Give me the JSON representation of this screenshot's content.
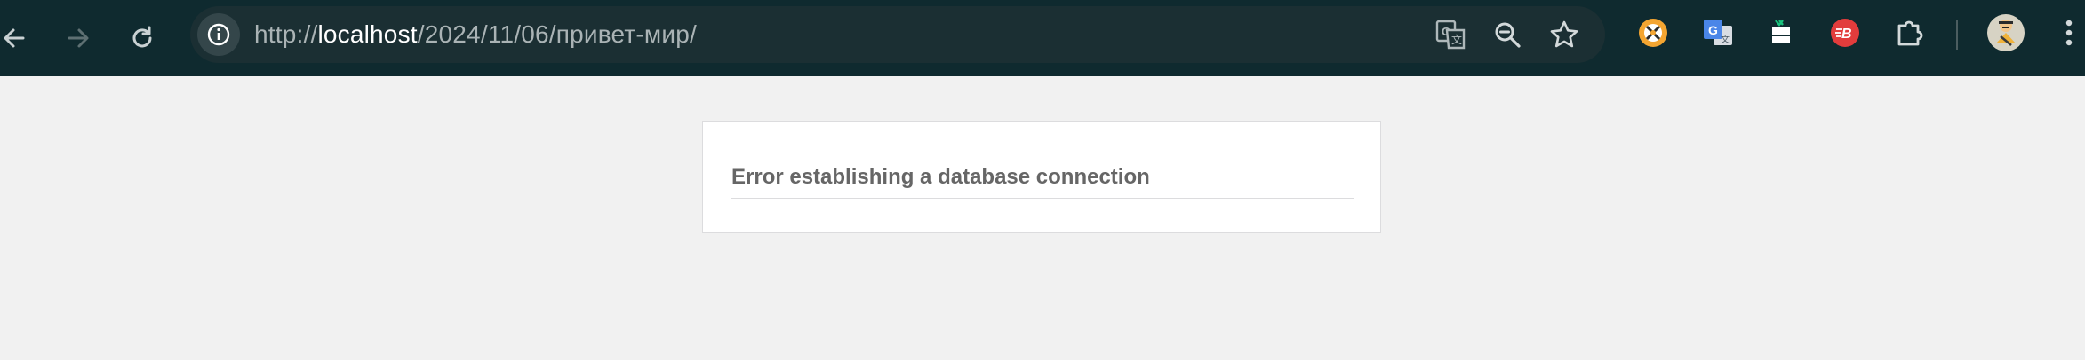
{
  "browser": {
    "url_scheme": "http://",
    "url_host": "localhost",
    "url_path": "/2024/11/06/привет-мир/",
    "nav": {
      "back_icon": "arrow-left-icon",
      "forward_icon": "arrow-right-icon",
      "reload_icon": "reload-icon"
    },
    "omnibox_icons": [
      "info-icon",
      "translate-icon",
      "zoom-out-icon",
      "star-icon"
    ],
    "extensions": [
      "crosshair-extension-icon",
      "google-translate-icon",
      "bookmark-tool-icon",
      "red-b-extension-icon",
      "puzzle-icon",
      "avatar",
      "menu-dots-icon"
    ],
    "colors": {
      "toolbar": "#0f2a2f",
      "omnibox": "#1b2f33"
    }
  },
  "page": {
    "error_message": "Error establishing a database connection",
    "background": "#f1f1f1"
  }
}
